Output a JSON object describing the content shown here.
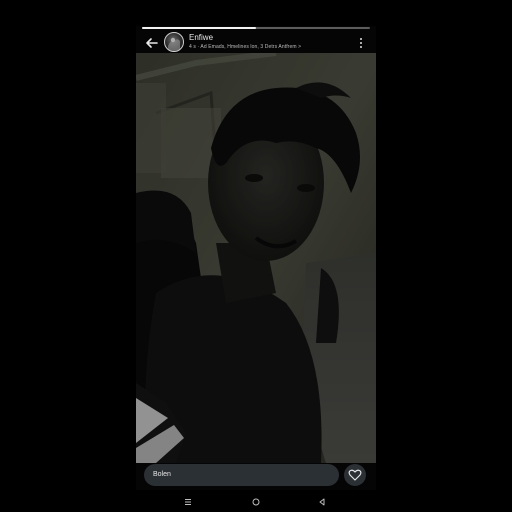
{
  "story": {
    "progress": 0.5
  },
  "header": {
    "username": "Enfiwe",
    "subtitle": "4 s · Ad Emads, Hmelines lon, 3 Detrs Antfrem >"
  },
  "footer": {
    "reply_placeholder": "Bolen"
  },
  "icons": {
    "back": "back-arrow-icon",
    "more": "more-vertical-icon",
    "like": "heart-icon",
    "nav_recents": "recents-icon",
    "nav_home": "home-icon",
    "nav_back": "back-triangle-icon"
  },
  "colors": {
    "background": "#000000",
    "field": "#2b3034",
    "text": "#e8e8e8"
  }
}
